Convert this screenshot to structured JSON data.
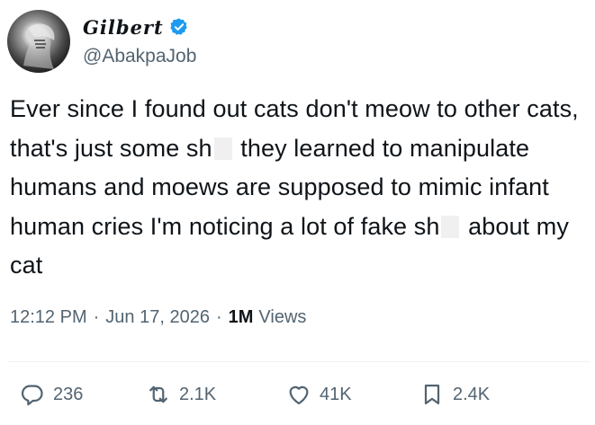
{
  "author": {
    "display_name": "Gilbert",
    "handle": "@AbakpaJob",
    "verified": true,
    "verified_color": "#1d9bf0"
  },
  "post": {
    "segments": [
      "Ever since I found out cats don't meow to other cats, that's just some sh",
      "they learned to manipulate humans and moews are supposed to mimic infant human cries I'm noticing a lot of fake sh",
      "about my cat"
    ]
  },
  "meta": {
    "time": "12:12 PM",
    "separator": "·",
    "date": "Jun 17, 2026",
    "views_count": "1M",
    "views_label": "Views"
  },
  "actions": {
    "replies": "236",
    "reposts": "2.1K",
    "likes": "41K",
    "bookmarks": "2.4K"
  },
  "icons": [
    "verified-badge-icon",
    "reply-icon",
    "repost-icon",
    "like-icon",
    "bookmark-icon"
  ]
}
